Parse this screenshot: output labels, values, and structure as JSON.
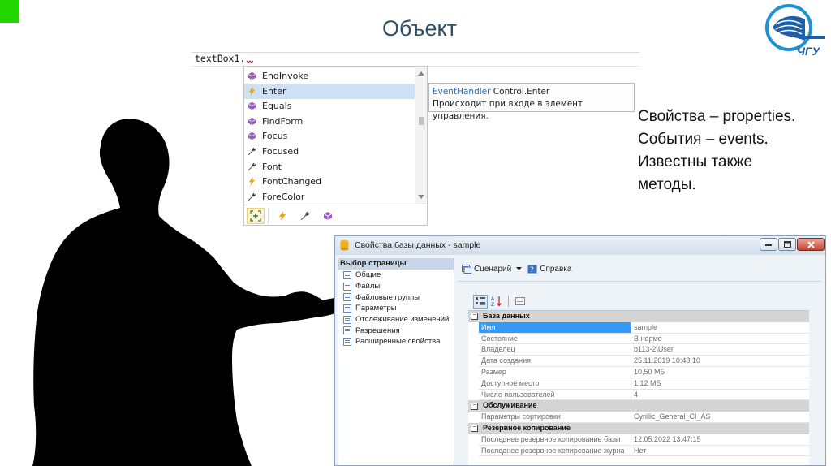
{
  "slide": {
    "title": "Объект",
    "description": "Свойства – properties.\nСобытия – events.\nИзвестны также\nметоды.",
    "logo_text": "ЧГУ",
    "accent_color": "#22d500"
  },
  "editor": {
    "code": "textBox1."
  },
  "intellisense": {
    "items": [
      {
        "label": "EndInvoke",
        "icon": "method-icon"
      },
      {
        "label": "Enter",
        "icon": "event-icon",
        "selected": true
      },
      {
        "label": "Equals",
        "icon": "method-icon"
      },
      {
        "label": "FindForm",
        "icon": "method-icon"
      },
      {
        "label": "Focus",
        "icon": "method-icon"
      },
      {
        "label": "Focused",
        "icon": "property-icon"
      },
      {
        "label": "Font",
        "icon": "property-icon"
      },
      {
        "label": "FontChanged",
        "icon": "event-icon"
      },
      {
        "label": "ForeColor",
        "icon": "property-icon"
      }
    ],
    "filters": [
      "all-members-icon",
      "event-icon",
      "property-icon",
      "method-icon"
    ]
  },
  "tooltip": {
    "type_keyword": "EventHandler",
    "member": " Control.Enter",
    "description": "Происходит при входе в элемент управления."
  },
  "dialog": {
    "title": "Свойства базы данных - sample",
    "left_pane": {
      "header": "Выбор страницы",
      "items": [
        "Общие",
        "Файлы",
        "Файловые группы",
        "Параметры",
        "Отслеживание изменений",
        "Разрешения",
        "Расширенные свойства"
      ]
    },
    "toolbar": {
      "script_label": "Сценарий",
      "help_label": "Справка"
    },
    "grid": [
      {
        "category": "База данных"
      },
      {
        "name": "Имя",
        "value": "sample",
        "selected": true
      },
      {
        "name": "Состояние",
        "value": "В норме"
      },
      {
        "name": "Владелец",
        "value": "b113-2\\User"
      },
      {
        "name": "Дата создания",
        "value": "25.11.2019 10:48:10"
      },
      {
        "name": "Размер",
        "value": "10,50 МБ"
      },
      {
        "name": "Доступное место",
        "value": "1,12 МБ"
      },
      {
        "name": "Число пользователей",
        "value": "4"
      },
      {
        "category": "Обслуживание"
      },
      {
        "name": "Параметры сортировки",
        "value": "Cyrillic_General_CI_AS"
      },
      {
        "category": "Резервное копирование"
      },
      {
        "name": "Последнее резервное копирование базы",
        "value": "12.05.2022 13:47:15"
      },
      {
        "name": "Последнее резервное копирование журна",
        "value": "Нет"
      }
    ]
  }
}
